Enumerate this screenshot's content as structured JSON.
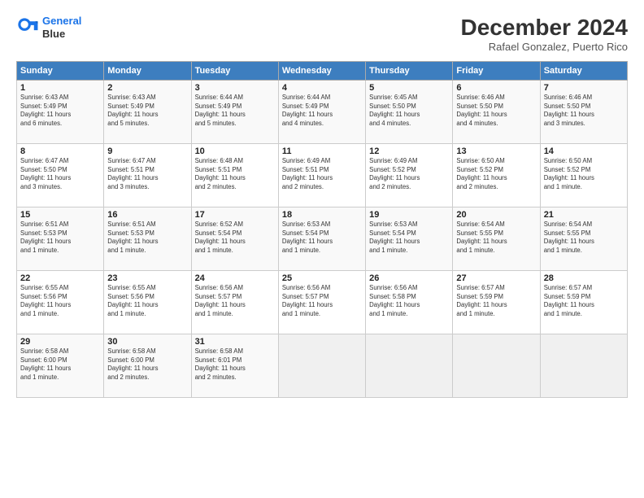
{
  "header": {
    "logo_line1": "General",
    "logo_line2": "Blue",
    "month": "December 2024",
    "location": "Rafael Gonzalez, Puerto Rico"
  },
  "days_of_week": [
    "Sunday",
    "Monday",
    "Tuesday",
    "Wednesday",
    "Thursday",
    "Friday",
    "Saturday"
  ],
  "weeks": [
    [
      {
        "day": "1",
        "info": "Sunrise: 6:43 AM\nSunset: 5:49 PM\nDaylight: 11 hours\nand 6 minutes."
      },
      {
        "day": "2",
        "info": "Sunrise: 6:43 AM\nSunset: 5:49 PM\nDaylight: 11 hours\nand 5 minutes."
      },
      {
        "day": "3",
        "info": "Sunrise: 6:44 AM\nSunset: 5:49 PM\nDaylight: 11 hours\nand 5 minutes."
      },
      {
        "day": "4",
        "info": "Sunrise: 6:44 AM\nSunset: 5:49 PM\nDaylight: 11 hours\nand 4 minutes."
      },
      {
        "day": "5",
        "info": "Sunrise: 6:45 AM\nSunset: 5:50 PM\nDaylight: 11 hours\nand 4 minutes."
      },
      {
        "day": "6",
        "info": "Sunrise: 6:46 AM\nSunset: 5:50 PM\nDaylight: 11 hours\nand 4 minutes."
      },
      {
        "day": "7",
        "info": "Sunrise: 6:46 AM\nSunset: 5:50 PM\nDaylight: 11 hours\nand 3 minutes."
      }
    ],
    [
      {
        "day": "8",
        "info": "Sunrise: 6:47 AM\nSunset: 5:50 PM\nDaylight: 11 hours\nand 3 minutes."
      },
      {
        "day": "9",
        "info": "Sunrise: 6:47 AM\nSunset: 5:51 PM\nDaylight: 11 hours\nand 3 minutes."
      },
      {
        "day": "10",
        "info": "Sunrise: 6:48 AM\nSunset: 5:51 PM\nDaylight: 11 hours\nand 2 minutes."
      },
      {
        "day": "11",
        "info": "Sunrise: 6:49 AM\nSunset: 5:51 PM\nDaylight: 11 hours\nand 2 minutes."
      },
      {
        "day": "12",
        "info": "Sunrise: 6:49 AM\nSunset: 5:52 PM\nDaylight: 11 hours\nand 2 minutes."
      },
      {
        "day": "13",
        "info": "Sunrise: 6:50 AM\nSunset: 5:52 PM\nDaylight: 11 hours\nand 2 minutes."
      },
      {
        "day": "14",
        "info": "Sunrise: 6:50 AM\nSunset: 5:52 PM\nDaylight: 11 hours\nand 1 minute."
      }
    ],
    [
      {
        "day": "15",
        "info": "Sunrise: 6:51 AM\nSunset: 5:53 PM\nDaylight: 11 hours\nand 1 minute."
      },
      {
        "day": "16",
        "info": "Sunrise: 6:51 AM\nSunset: 5:53 PM\nDaylight: 11 hours\nand 1 minute."
      },
      {
        "day": "17",
        "info": "Sunrise: 6:52 AM\nSunset: 5:54 PM\nDaylight: 11 hours\nand 1 minute."
      },
      {
        "day": "18",
        "info": "Sunrise: 6:53 AM\nSunset: 5:54 PM\nDaylight: 11 hours\nand 1 minute."
      },
      {
        "day": "19",
        "info": "Sunrise: 6:53 AM\nSunset: 5:54 PM\nDaylight: 11 hours\nand 1 minute."
      },
      {
        "day": "20",
        "info": "Sunrise: 6:54 AM\nSunset: 5:55 PM\nDaylight: 11 hours\nand 1 minute."
      },
      {
        "day": "21",
        "info": "Sunrise: 6:54 AM\nSunset: 5:55 PM\nDaylight: 11 hours\nand 1 minute."
      }
    ],
    [
      {
        "day": "22",
        "info": "Sunrise: 6:55 AM\nSunset: 5:56 PM\nDaylight: 11 hours\nand 1 minute."
      },
      {
        "day": "23",
        "info": "Sunrise: 6:55 AM\nSunset: 5:56 PM\nDaylight: 11 hours\nand 1 minute."
      },
      {
        "day": "24",
        "info": "Sunrise: 6:56 AM\nSunset: 5:57 PM\nDaylight: 11 hours\nand 1 minute."
      },
      {
        "day": "25",
        "info": "Sunrise: 6:56 AM\nSunset: 5:57 PM\nDaylight: 11 hours\nand 1 minute."
      },
      {
        "day": "26",
        "info": "Sunrise: 6:56 AM\nSunset: 5:58 PM\nDaylight: 11 hours\nand 1 minute."
      },
      {
        "day": "27",
        "info": "Sunrise: 6:57 AM\nSunset: 5:59 PM\nDaylight: 11 hours\nand 1 minute."
      },
      {
        "day": "28",
        "info": "Sunrise: 6:57 AM\nSunset: 5:59 PM\nDaylight: 11 hours\nand 1 minute."
      }
    ],
    [
      {
        "day": "29",
        "info": "Sunrise: 6:58 AM\nSunset: 6:00 PM\nDaylight: 11 hours\nand 1 minute."
      },
      {
        "day": "30",
        "info": "Sunrise: 6:58 AM\nSunset: 6:00 PM\nDaylight: 11 hours\nand 2 minutes."
      },
      {
        "day": "31",
        "info": "Sunrise: 6:58 AM\nSunset: 6:01 PM\nDaylight: 11 hours\nand 2 minutes."
      },
      null,
      null,
      null,
      null
    ]
  ]
}
